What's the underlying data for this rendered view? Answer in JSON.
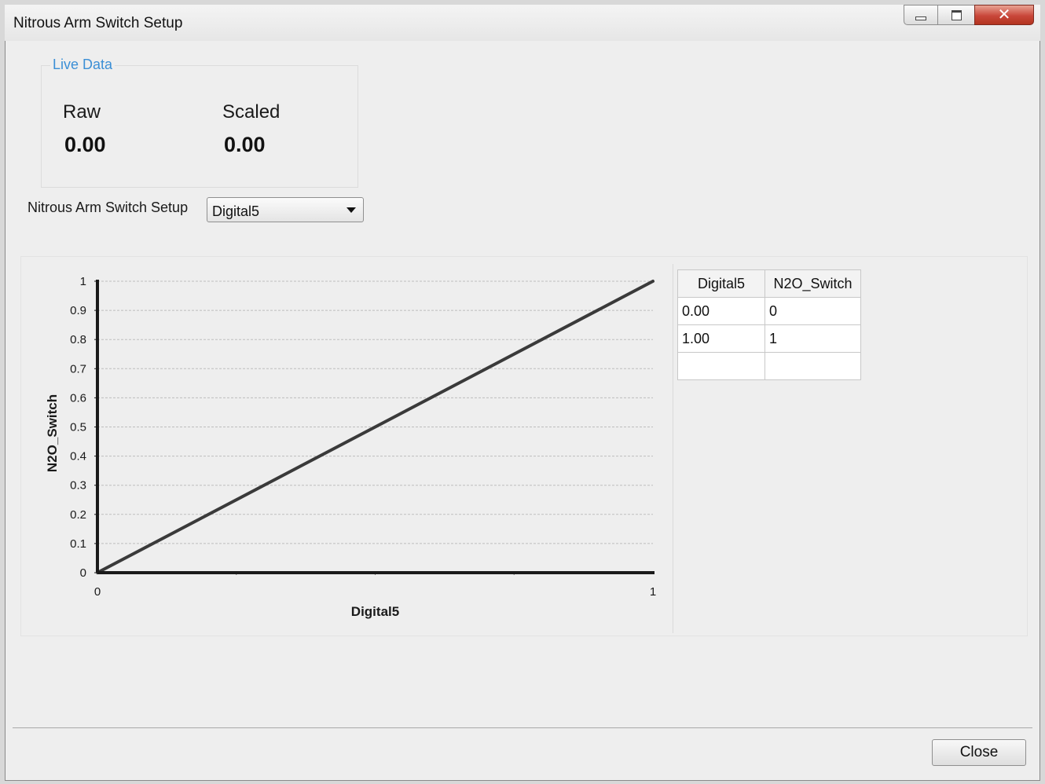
{
  "window": {
    "title": "Nitrous Arm Switch Setup",
    "buttons": {
      "minimize": "minimize-icon",
      "maximize": "maximize-icon",
      "close": "close-icon"
    }
  },
  "live_data": {
    "legend": "Live Data",
    "raw_label": "Raw",
    "raw_value": "0.00",
    "scaled_label": "Scaled",
    "scaled_value": "0.00"
  },
  "setup": {
    "label": "Nitrous Arm Switch Setup",
    "selected": "Digital5"
  },
  "table": {
    "headers": [
      "Digital5",
      "N2O_Switch"
    ],
    "rows": [
      [
        "0.00",
        "0"
      ],
      [
        "1.00",
        "1"
      ],
      [
        "",
        ""
      ]
    ]
  },
  "chart_data": {
    "type": "line",
    "xlabel": "Digital5",
    "ylabel": "N2O_Switch",
    "xlim": [
      0,
      1
    ],
    "ylim": [
      0,
      1
    ],
    "x_ticks": [
      "0",
      "1"
    ],
    "y_ticks": [
      "0",
      "0.1",
      "0.2",
      "0.3",
      "0.4",
      "0.5",
      "0.6",
      "0.7",
      "0.8",
      "0.9",
      "1"
    ],
    "grid": true,
    "series": [
      {
        "x": [
          0,
          1
        ],
        "y": [
          0,
          1
        ]
      }
    ],
    "colors": {
      "line": "#3a3a3a",
      "grid": "#bdbdbd",
      "axis": "#1a1a1a"
    }
  },
  "footer": {
    "close_label": "Close"
  }
}
